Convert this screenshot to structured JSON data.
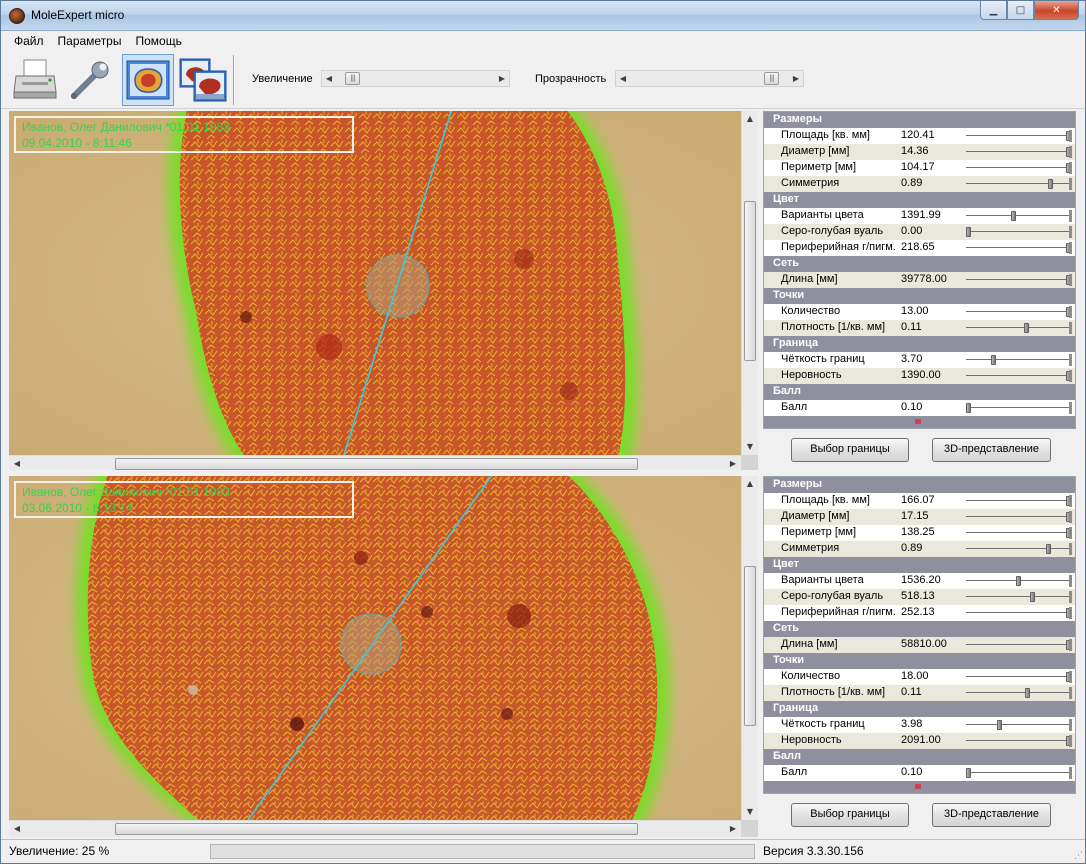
{
  "window": {
    "title": "MoleExpert micro",
    "minimize": "▁",
    "maximize": "□",
    "close": "✕"
  },
  "menu": [
    "Файл",
    "Параметры",
    "Помощь"
  ],
  "toolbar": {
    "buttons": [
      {
        "name": "printer-icon"
      },
      {
        "name": "wrench-icon"
      },
      {
        "name": "single-view-icon",
        "active": true
      },
      {
        "name": "compare-view-icon"
      }
    ],
    "zoom_label": "Увеличение",
    "zoom_level": 0.06,
    "opacity_label": "Прозрачность",
    "opacity_level": 0.93
  },
  "panes": [
    {
      "patient_line": "Иванов, Олег Данилович   *01.01.1983",
      "date_line": "09.04.2010 - 8:11:46"
    },
    {
      "patient_line": "Иванов, Олег Данилович   *01.01.1983",
      "date_line": "03.06.2010 - 8:13:14"
    }
  ],
  "measurements": [
    {
      "sections": [
        {
          "title": "Размеры",
          "rows": [
            {
              "label": "Площадь [кв. мм]",
              "value": "120.41",
              "level": 1.0
            },
            {
              "label": "Диаметр [мм]",
              "value": "14.36",
              "level": 1.0
            },
            {
              "label": "Периметр [мм]",
              "value": "104.17",
              "level": 1.0
            },
            {
              "label": "Симметрия",
              "value": "0.89",
              "level": 0.82
            }
          ]
        },
        {
          "title": "Цвет",
          "rows": [
            {
              "label": "Варианты цвета",
              "value": "1391.99",
              "level": 0.45
            },
            {
              "label": "Серо-голубая вуаль",
              "value": "0.00",
              "level": 0.0
            },
            {
              "label": "Периферийная г/пигм.",
              "value": "218.65",
              "level": 1.0
            }
          ]
        },
        {
          "title": "Сеть",
          "rows": [
            {
              "label": "Длина [мм]",
              "value": "39778.00",
              "level": 1.0
            }
          ]
        },
        {
          "title": "Точки",
          "rows": [
            {
              "label": "Количество",
              "value": "13.00",
              "level": 1.0
            },
            {
              "label": "Плотность [1/кв. мм]",
              "value": "0.11",
              "level": 0.58
            }
          ]
        },
        {
          "title": "Граница",
          "rows": [
            {
              "label": "Чёткость границ",
              "value": "3.70",
              "level": 0.25
            },
            {
              "label": "Неровность",
              "value": "1390.00",
              "level": 1.0
            }
          ]
        },
        {
          "title": "Балл",
          "rows": [
            {
              "label": "Балл",
              "value": "0.10",
              "level": 0.0
            }
          ]
        }
      ]
    },
    {
      "sections": [
        {
          "title": "Размеры",
          "rows": [
            {
              "label": "Площадь [кв. мм]",
              "value": "166.07",
              "level": 1.0
            },
            {
              "label": "Диаметр [мм]",
              "value": "17.15",
              "level": 1.0
            },
            {
              "label": "Периметр [мм]",
              "value": "138.25",
              "level": 1.0
            },
            {
              "label": "Симметрия",
              "value": "0.89",
              "level": 0.8
            }
          ]
        },
        {
          "title": "Цвет",
          "rows": [
            {
              "label": "Варианты цвета",
              "value": "1536.20",
              "level": 0.5
            },
            {
              "label": "Серо-голубая вуаль",
              "value": "518.13",
              "level": 0.64
            },
            {
              "label": "Периферийная г/пигм.",
              "value": "252.13",
              "level": 1.0
            }
          ]
        },
        {
          "title": "Сеть",
          "rows": [
            {
              "label": "Длина [мм]",
              "value": "58810.00",
              "level": 1.0
            }
          ]
        },
        {
          "title": "Точки",
          "rows": [
            {
              "label": "Количество",
              "value": "18.00",
              "level": 1.0
            },
            {
              "label": "Плотность [1/кв. мм]",
              "value": "0.11",
              "level": 0.59
            }
          ]
        },
        {
          "title": "Граница",
          "rows": [
            {
              "label": "Чёткость границ",
              "value": "3.98",
              "level": 0.31
            },
            {
              "label": "Неровность",
              "value": "2091.00",
              "level": 1.0
            }
          ]
        },
        {
          "title": "Балл",
          "rows": [
            {
              "label": "Балл",
              "value": "0.10",
              "level": 0.0
            }
          ]
        }
      ]
    }
  ],
  "panel_buttons": {
    "border_select": "Выбор границы",
    "view_3d": "3D-представление"
  },
  "status": {
    "zoom_text": "Увеличение: 25 %",
    "version": "Версия 3.3.30.156"
  },
  "colors": {
    "lesion": "#c9582a",
    "border_glow": "#6fe02a",
    "network": "#f4d020",
    "axis_line": "#3fc8d8",
    "section_header": "#8f8f9f"
  }
}
